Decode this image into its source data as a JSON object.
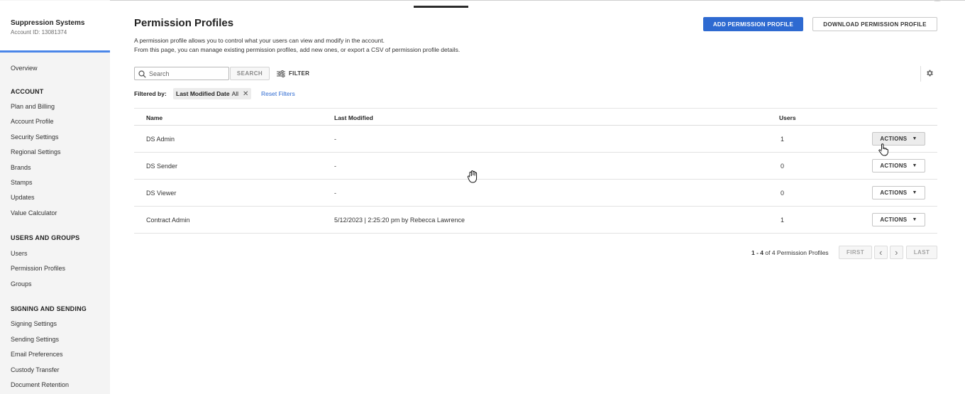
{
  "account": {
    "name": "Suppression Systems",
    "id": "Account ID: 13081374"
  },
  "sidebar": {
    "overview": "Overview",
    "sections": [
      {
        "heading": "ACCOUNT",
        "items": [
          "Plan and Billing",
          "Account Profile",
          "Security Settings",
          "Regional Settings",
          "Brands",
          "Stamps",
          "Updates",
          "Value Calculator"
        ]
      },
      {
        "heading": "USERS AND GROUPS",
        "items": [
          "Users",
          "Permission Profiles",
          "Groups"
        ]
      },
      {
        "heading": "SIGNING AND SENDING",
        "items": [
          "Signing Settings",
          "Sending Settings",
          "Email Preferences",
          "Custody Transfer",
          "Document Retention"
        ]
      }
    ]
  },
  "page": {
    "title": "Permission Profiles",
    "description_line1": "A permission profile allows you to control what your users can view and modify in the account.",
    "description_line2": "From this page, you can manage existing permission profiles, add new ones, or export a CSV of permission profile details.",
    "add_button": "ADD PERMISSION PROFILE",
    "download_button": "DOWNLOAD PERMISSION PROFILE"
  },
  "search": {
    "placeholder": "Search",
    "button": "SEARCH",
    "filter": "FILTER"
  },
  "filters": {
    "label": "Filtered by:",
    "chip_field": "Last Modified Date",
    "chip_value": "All",
    "reset": "Reset Filters"
  },
  "table": {
    "columns": [
      "Name",
      "Last Modified",
      "Users"
    ],
    "rows": [
      {
        "name": "DS Admin",
        "last_modified": "-",
        "users": "1",
        "action": "ACTIONS"
      },
      {
        "name": "DS Sender",
        "last_modified": "-",
        "users": "0",
        "action": "ACTIONS"
      },
      {
        "name": "DS Viewer",
        "last_modified": "-",
        "users": "0",
        "action": "ACTIONS"
      },
      {
        "name": "Contract Admin",
        "last_modified": "5/12/2023 | 2:25:20 pm by Rebecca Lawrence",
        "users": "1",
        "action": "ACTIONS"
      }
    ]
  },
  "pagination": {
    "range": "1 - 4",
    "summary": "of 4 Permission Profiles",
    "first": "FIRST",
    "prev": "‹",
    "next": "›",
    "last": "LAST"
  },
  "colors": {
    "primary": "#2e6ad1",
    "sidebar_bg": "#f4f4f4",
    "accent_line": "#4a86e8"
  }
}
